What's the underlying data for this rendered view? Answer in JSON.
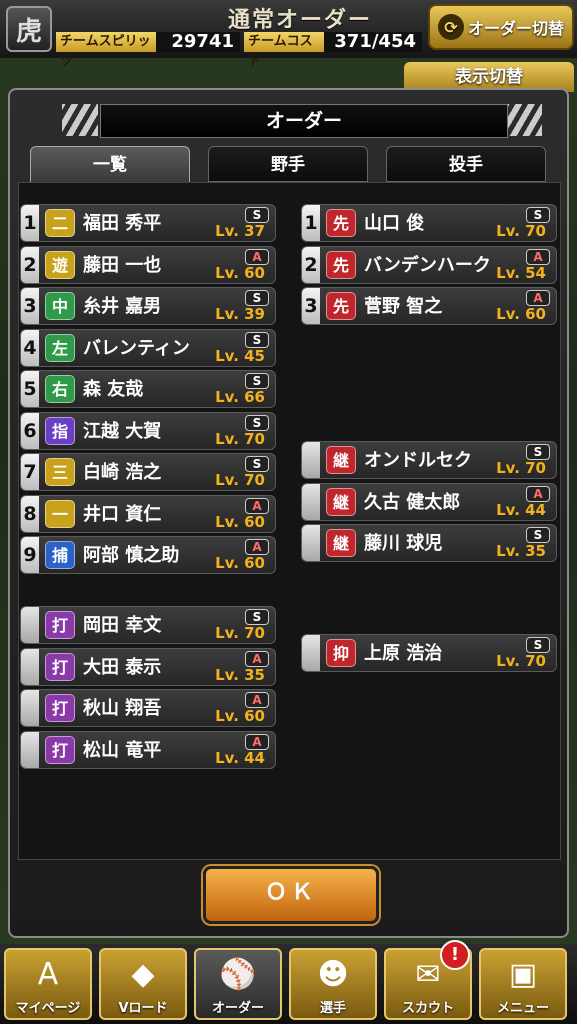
{
  "header": {
    "logo": "虎",
    "title": "通常オーダー",
    "team_spirits_label": "チームスピリッツ",
    "team_spirits_value": "29741",
    "team_cost_label": "チームコスト",
    "team_cost_value": "371/454",
    "order_switch_label": "オーダー切替",
    "display_switch_label": "表示切替"
  },
  "modal": {
    "title": "オーダー",
    "tabs": [
      "一覧",
      "野手",
      "投手"
    ],
    "ok_label": "ＯＫ"
  },
  "batters": [
    {
      "num": "1",
      "pos": "二",
      "name": "福田 秀平",
      "rank": "S",
      "lv": "Lv. 37"
    },
    {
      "num": "2",
      "pos": "遊",
      "name": "藤田 一也",
      "rank": "A",
      "lv": "Lv. 60"
    },
    {
      "num": "3",
      "pos": "中",
      "name": "糸井 嘉男",
      "rank": "S",
      "lv": "Lv. 39"
    },
    {
      "num": "4",
      "pos": "左",
      "name": "バレンティン",
      "rank": "S",
      "lv": "Lv. 45"
    },
    {
      "num": "5",
      "pos": "右",
      "name": "森 友哉",
      "rank": "S",
      "lv": "Lv. 66"
    },
    {
      "num": "6",
      "pos": "指",
      "name": "江越 大賀",
      "rank": "S",
      "lv": "Lv. 70"
    },
    {
      "num": "7",
      "pos": "三",
      "name": "白崎 浩之",
      "rank": "S",
      "lv": "Lv. 70"
    },
    {
      "num": "8",
      "pos": "一",
      "name": "井口 資仁",
      "rank": "A",
      "lv": "Lv. 60"
    },
    {
      "num": "9",
      "pos": "捕",
      "name": "阿部 慎之助",
      "rank": "A",
      "lv": "Lv. 60"
    }
  ],
  "pinch_hitters": [
    {
      "pos": "打",
      "name": "岡田 幸文",
      "rank": "S",
      "lv": "Lv. 70"
    },
    {
      "pos": "打",
      "name": "大田 泰示",
      "rank": "A",
      "lv": "Lv. 35"
    },
    {
      "pos": "打",
      "name": "秋山 翔吾",
      "rank": "A",
      "lv": "Lv. 60"
    },
    {
      "pos": "打",
      "name": "松山 竜平",
      "rank": "A",
      "lv": "Lv. 44"
    }
  ],
  "starters": [
    {
      "num": "1",
      "pos": "先",
      "name": "山口 俊",
      "rank": "S",
      "lv": "Lv. 70"
    },
    {
      "num": "2",
      "pos": "先",
      "name": "バンデンハーク",
      "rank": "A",
      "lv": "Lv. 54"
    },
    {
      "num": "3",
      "pos": "先",
      "name": "菅野 智之",
      "rank": "A",
      "lv": "Lv. 60"
    }
  ],
  "relievers": [
    {
      "pos": "継",
      "name": "オンドルセク",
      "rank": "S",
      "lv": "Lv. 70"
    },
    {
      "pos": "継",
      "name": "久古 健太郎",
      "rank": "A",
      "lv": "Lv. 44"
    },
    {
      "pos": "継",
      "name": "藤川 球児",
      "rank": "S",
      "lv": "Lv. 35"
    }
  ],
  "closer": {
    "pos": "抑",
    "name": "上原 浩治",
    "rank": "S",
    "lv": "Lv. 70"
  },
  "pos_colors": {
    "二": "#c9a21c",
    "遊": "#c9a21c",
    "三": "#c9a21c",
    "一": "#c9a21c",
    "中": "#2e9a4a",
    "左": "#2e9a4a",
    "右": "#2e9a4a",
    "指": "#6b3fc4",
    "捕": "#2a62c9",
    "打": "#8a3aa8",
    "先": "#c0272d",
    "継": "#c0272d",
    "抑": "#c0272d"
  },
  "nav": [
    {
      "label": "マイページ",
      "icon": "A"
    },
    {
      "label": "Vロード",
      "icon": "◆"
    },
    {
      "label": "オーダー",
      "icon": "⚾"
    },
    {
      "label": "選手",
      "icon": "☻"
    },
    {
      "label": "スカウト",
      "icon": "✉"
    },
    {
      "label": "メニュー",
      "icon": "▣"
    }
  ],
  "scout_badge": "!"
}
